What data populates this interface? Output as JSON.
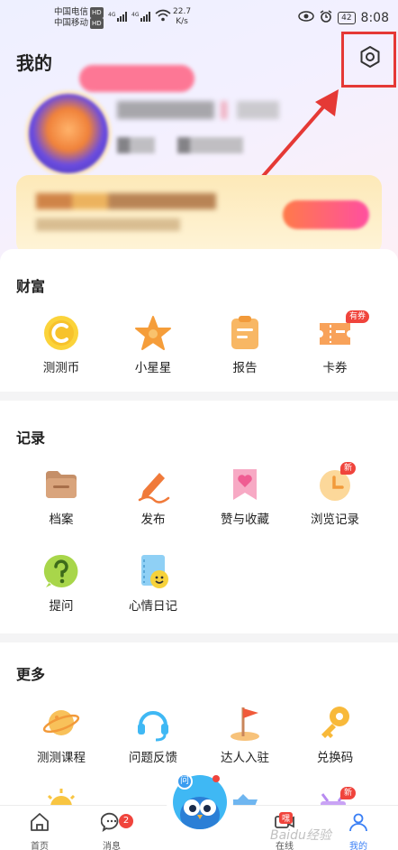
{
  "status_bar": {
    "carrier1": "中国电信",
    "carrier2": "中国移动",
    "hd": "HD",
    "net1": "4G",
    "net2": "4G",
    "speed_value": "22.7",
    "speed_unit": "K/s",
    "battery": "42",
    "time": "8:08"
  },
  "header": {
    "title": "我的",
    "settings_icon": "gear-icon"
  },
  "wealth": {
    "title": "财富",
    "items": [
      {
        "label": "测测币",
        "icon": "coin-icon",
        "color": "#f7c22b"
      },
      {
        "label": "小星星",
        "icon": "star-icon",
        "color": "#f59d3a"
      },
      {
        "label": "报告",
        "icon": "clipboard-icon",
        "color": "#f8b764"
      },
      {
        "label": "卡券",
        "icon": "ticket-icon",
        "color": "#f8a25a",
        "tag": "有券"
      }
    ]
  },
  "records": {
    "title": "记录",
    "items": [
      {
        "label": "档案",
        "icon": "folder-icon"
      },
      {
        "label": "发布",
        "icon": "pen-icon"
      },
      {
        "label": "赞与收藏",
        "icon": "bookmark-heart-icon"
      },
      {
        "label": "浏览记录",
        "icon": "history-icon",
        "tag": "新"
      },
      {
        "label": "提问",
        "icon": "question-icon"
      },
      {
        "label": "心情日记",
        "icon": "diary-icon"
      }
    ]
  },
  "more": {
    "title": "更多",
    "items": [
      {
        "label": "测测课程",
        "icon": "planet-icon"
      },
      {
        "label": "问题反馈",
        "icon": "headset-icon"
      },
      {
        "label": "达人入驻",
        "icon": "flag-icon"
      },
      {
        "label": "兑换码",
        "icon": "key-icon"
      }
    ],
    "extra_tag": "新"
  },
  "bottom_nav": {
    "home": "首页",
    "messages": "消息",
    "messages_badge": "2",
    "center": "问",
    "live": "在线",
    "live_tag": "嘿",
    "me": "我的"
  },
  "watermark": "Baidu经验"
}
